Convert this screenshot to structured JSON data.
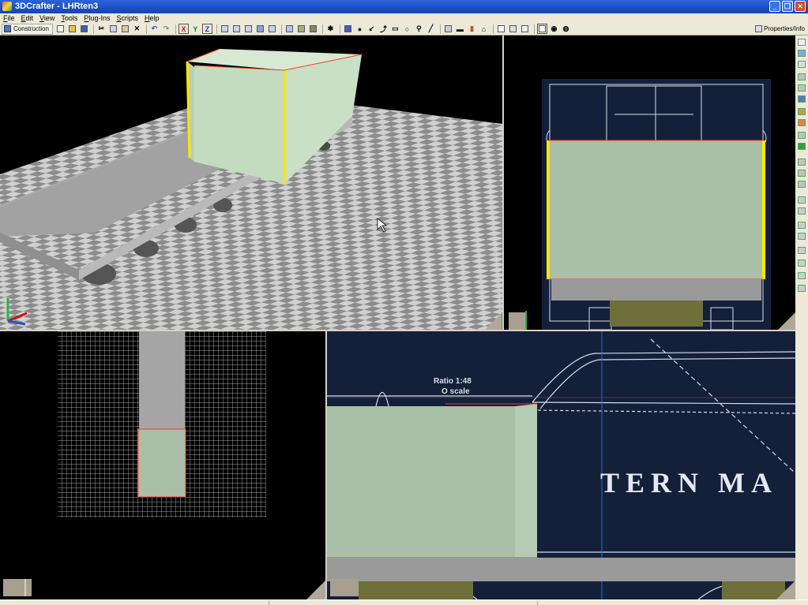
{
  "window": {
    "title": "3DCrafter - LHRten3"
  },
  "menu": [
    "File",
    "Edit",
    "View",
    "Tools",
    "Plug-Ins",
    "Scripts",
    "Help"
  ],
  "toolbar": {
    "mode_label": "Construction",
    "axis_labels": {
      "x": "X",
      "y": "Y",
      "z": "Z"
    },
    "properties_label": "Properties/Info"
  },
  "viewports": {
    "front": {
      "ratio_text": "Ratio 1:48",
      "scale_text": "O scale",
      "lettering": "TERN MA"
    }
  },
  "colors": {
    "viewport_bg": "#000000",
    "model_face": "#c6dcc4",
    "model_face_dark": "#a9bfa8",
    "platform_gray": "#a5a5a5",
    "edge_highlight": "#ffe600",
    "edge_selection": "#ff3b1f",
    "blueprint": "#14203a"
  }
}
